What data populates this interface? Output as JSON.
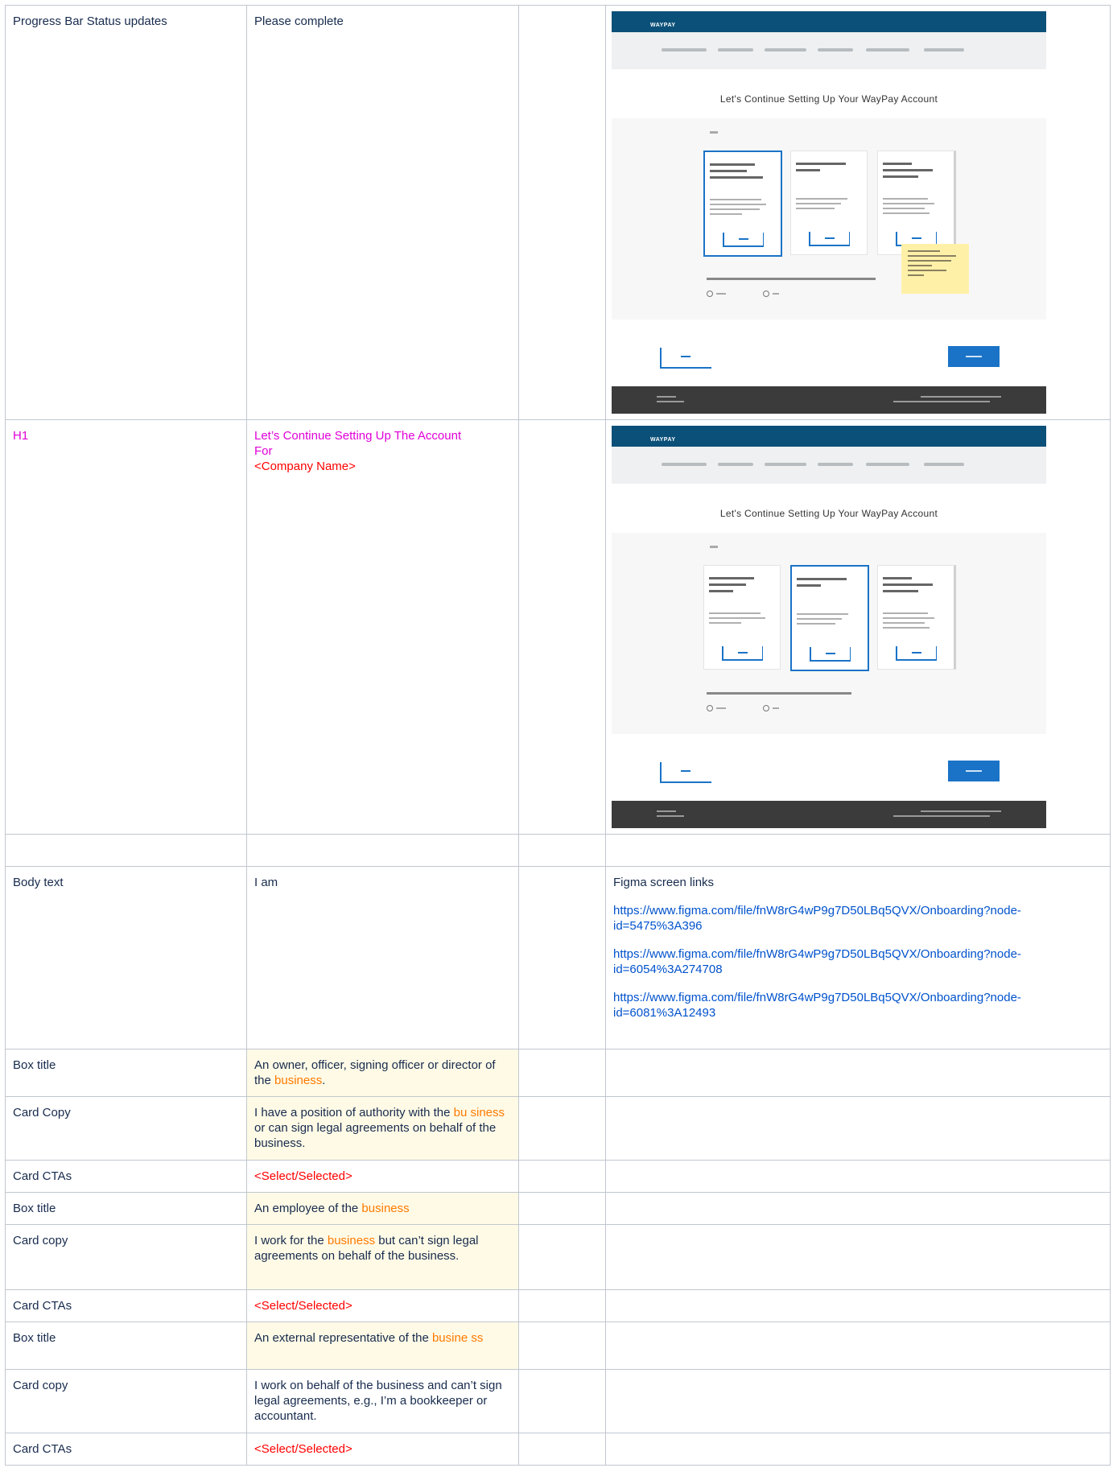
{
  "rows": [
    {
      "label": "Progress Bar Status updates",
      "value": "Please complete"
    },
    {
      "label": "H1",
      "value_line1": "Let’s Continue Setting Up The Account",
      "value_line2": "For",
      "value_line3": "<Company Name>"
    },
    {
      "label": "",
      "value": ""
    },
    {
      "label": "Body text",
      "value": "I am"
    },
    {
      "label": "Box title",
      "value_pre": "An owner, officer, signing officer or director of the ",
      "value_hl": "business",
      "value_post": "."
    },
    {
      "label": "Card Copy",
      "value_pre": "I have a position of authority with the ",
      "value_hl": "bu siness",
      "value_post": " or can sign legal agreements on behalf of the business."
    },
    {
      "label": "Card CTAs",
      "value": "<Select/Selected>"
    },
    {
      "label": "Box title",
      "value_pre": "An employee of the ",
      "value_hl": "business",
      "value_post": ""
    },
    {
      "label": "Card copy",
      "value_pre": "I work for the ",
      "value_hl": "business",
      "value_post": " but can’t sign legal agreements on behalf of the business."
    },
    {
      "label": "Card CTAs",
      "value": "<Select/Selected>"
    },
    {
      "label": "Box title",
      "value_pre": "An external representative of the ",
      "value_hl": "busine ss",
      "value_post": ""
    },
    {
      "label": "Card copy",
      "value": "I work on behalf of the business and can’t sign legal agreements, e.g., I’m a bookkeeper or accountant."
    },
    {
      "label": "Card CTAs",
      "value": "<Select/Selected>"
    }
  ],
  "figma": {
    "title": "Figma screen links",
    "links": [
      "https://www.figma.com/file/fnW8rG4wP9g7D50LBq5QVX/Onboarding?node-id=5475%3A396",
      "https://www.figma.com/file/fnW8rG4wP9g7D50LBq5QVX/Onboarding?node-id=6054%3A274708",
      "https://www.figma.com/file/fnW8rG4wP9g7D50LBq5QVX/Onboarding?node-id=6081%3A12493"
    ]
  },
  "mockup": {
    "brand": "WAYPAY",
    "heading": "Let's Continue Setting Up Your WayPay Account",
    "colors": {
      "topbar": "#0b5079",
      "accent": "#1a73c7",
      "footer": "#3b3b3b",
      "note": "#fff0a8"
    }
  }
}
